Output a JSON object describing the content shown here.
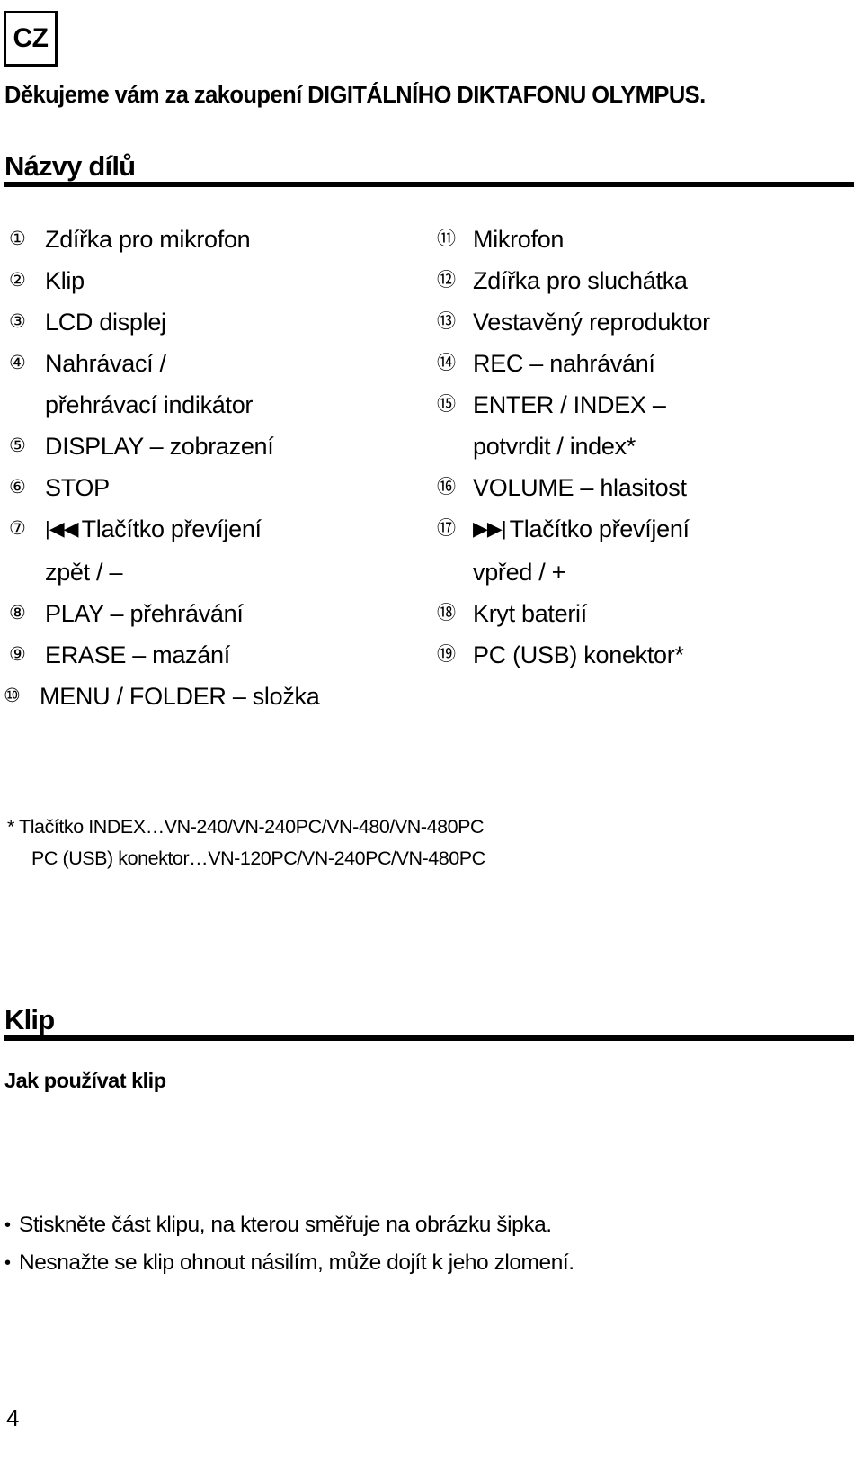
{
  "language_badge": "CZ",
  "thanks_line": "Děkujeme vám za zakoupení DIGITÁLNÍHO DIKTAFONU OLYMPUS.",
  "sections": {
    "parts": {
      "title": "Názvy dílů"
    },
    "clip": {
      "title": "Klip",
      "subheading": "Jak používat klip"
    }
  },
  "parts_left": [
    {
      "num": "①",
      "text": "Zdířka pro mikrofon",
      "cont": ""
    },
    {
      "num": "②",
      "text": "Klip",
      "cont": ""
    },
    {
      "num": "③",
      "text": "LCD displej",
      "cont": ""
    },
    {
      "num": "④",
      "text": "Nahrávací /",
      "cont": "přehrávací indikátor"
    },
    {
      "num": "⑤",
      "text": "DISPLAY – zobrazení",
      "cont": ""
    },
    {
      "num": "⑥",
      "text": "STOP",
      "cont": ""
    },
    {
      "num": "⑦",
      "icon": "rewind-icon",
      "glyph": "◀◀",
      "glyph_prefix": "|",
      "text": "Tlačítko převíjení",
      "cont": "zpět / –"
    },
    {
      "num": "⑧",
      "text": "PLAY – přehrávání",
      "cont": ""
    },
    {
      "num": "⑨",
      "text": "ERASE – mazání",
      "cont": ""
    },
    {
      "num": "⑩",
      "text": "MENU / FOLDER – složka",
      "cont": ""
    }
  ],
  "parts_right": [
    {
      "num": "⑪",
      "text": "Mikrofon",
      "cont": ""
    },
    {
      "num": "⑫",
      "text": "Zdířka pro sluchátka",
      "cont": ""
    },
    {
      "num": "⑬",
      "text": "Vestavěný reproduktor",
      "cont": ""
    },
    {
      "num": "⑭",
      "text": "REC – nahrávání",
      "cont": ""
    },
    {
      "num": "⑮",
      "text": "ENTER / INDEX –",
      "cont": "potvrdit / index*"
    },
    {
      "num": "⑯",
      "text": "VOLUME – hlasitost",
      "cont": ""
    },
    {
      "num": "⑰",
      "icon": "fast-forward-icon",
      "glyph": "▶▶",
      "glyph_suffix": "|",
      "text": "Tlačítko převíjení",
      "cont": "vpřed / +"
    },
    {
      "num": "⑱",
      "text": "Kryt baterií",
      "cont": ""
    },
    {
      "num": "⑲",
      "text": "PC (USB) konektor*",
      "cont": ""
    }
  ],
  "footnote": {
    "line1": "* Tlačítko INDEX…VN-240/VN-240PC/VN-480/VN-480PC",
    "line2": "PC (USB) konektor…VN-120PC/VN-240PC/VN-480PC"
  },
  "notes": [
    {
      "bullet": "•",
      "text": "Stiskněte část klipu, na kterou směřuje na obrázku šipka."
    },
    {
      "bullet": "•",
      "text": "Nesnažte se klip ohnout násilím, může dojít k jeho zlomení."
    }
  ],
  "page_number": "4",
  "colors": {
    "ink": "#000000",
    "paper": "#ffffff"
  }
}
